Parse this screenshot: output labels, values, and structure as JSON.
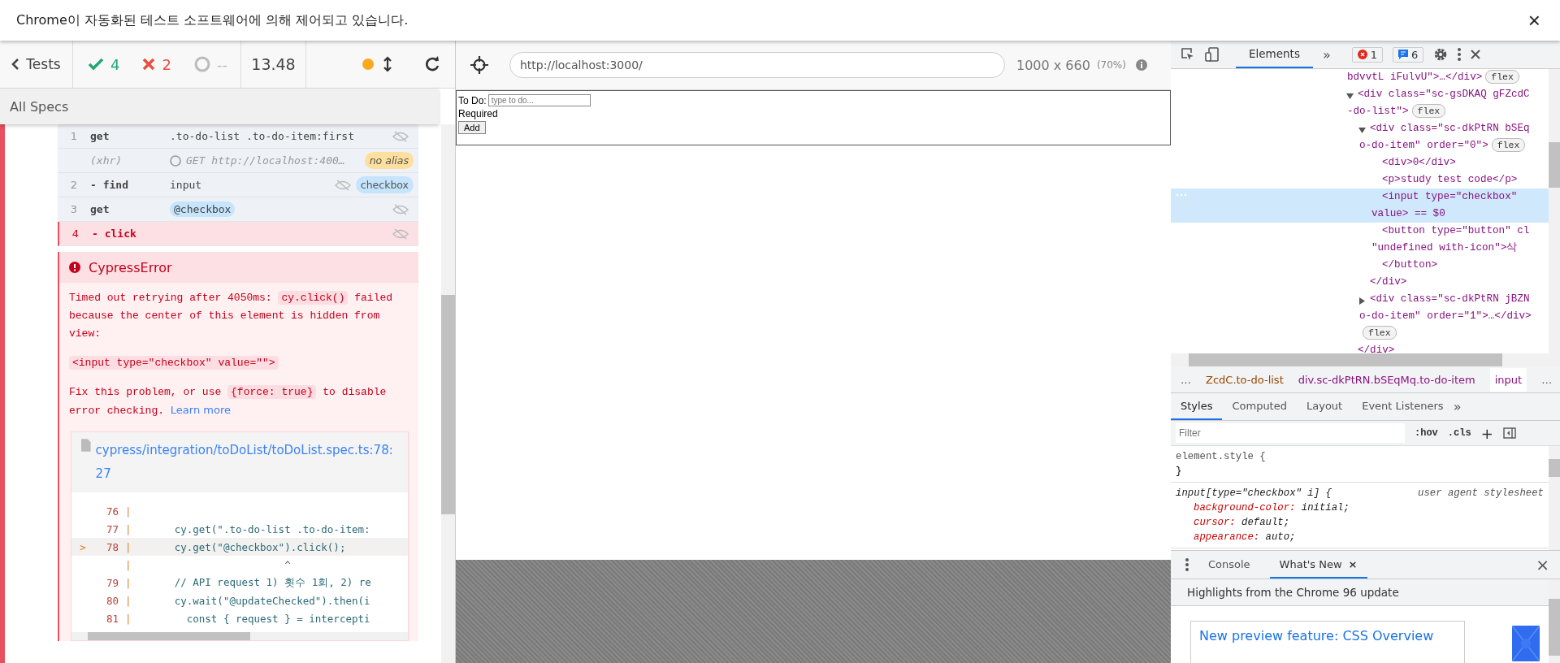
{
  "infobar": {
    "message": "Chrome이 자동화된 테스트 소프트웨어에 의해 제어되고 있습니다.",
    "close": "×"
  },
  "reporter": {
    "back": "Tests",
    "passed": "4",
    "failed": "2",
    "pending": "--",
    "duration": "13.48",
    "specs": "All Specs",
    "commands": [
      {
        "number": "1",
        "name": "get",
        "message": ".to-do-list .to-do-item:first",
        "kind": "command",
        "failed": false
      },
      {
        "name": "(xhr)",
        "message": "GET http://localhost:400…",
        "kind": "xhr",
        "failed": false,
        "alias": {
          "label": "no alias",
          "color": "#ffdf9e"
        }
      },
      {
        "number": "2",
        "name": "- find",
        "message": "input",
        "kind": "command",
        "failed": false,
        "alias": {
          "label": "checkbox",
          "color": "#c6e4fb"
        }
      },
      {
        "number": "3",
        "name": "get",
        "message": "@checkbox",
        "kind": "alias-ref",
        "failed": false
      },
      {
        "number": "4",
        "name": "- click",
        "kind": "command",
        "failed": true
      }
    ],
    "error": {
      "title": "CypressError",
      "paragraphs": [
        [
          {
            "text": "Timed out retrying after 4050ms: ",
            "kind": "text"
          },
          {
            "text": "cy.click()",
            "kind": "code"
          },
          {
            "text": " failed because the center of this element is hidden from view:",
            "kind": "text"
          }
        ],
        [
          {
            "text": "<input type=\"checkbox\" value=\"\">",
            "kind": "code"
          }
        ],
        [
          {
            "text": "Fix this problem, or use ",
            "kind": "text"
          },
          {
            "text": "{force: true}",
            "kind": "code"
          },
          {
            "text": " to disable error checking. ",
            "kind": "text"
          },
          {
            "text": "Learn more",
            "kind": "link"
          }
        ]
      ],
      "file": "cypress/integration/toDoList/toDoList.spec.ts:78:27",
      "code": [
        {
          "number": "76",
          "gutter": "|",
          "current": false
        },
        {
          "number": "77",
          "gutter": "|",
          "code": "      cy.get(\".to-do-list .to-do-item:",
          "current": false
        },
        {
          "marker": ">",
          "number": "78",
          "gutter": "|",
          "code": "      cy.get(\"@checkbox\").click();",
          "current": true
        },
        {
          "gutter": "|",
          "code": "                        ^",
          "current": false
        },
        {
          "number": "79",
          "gutter": "|",
          "code": "      // API request 1) 횟수 1회, 2) re",
          "current": false
        },
        {
          "number": "80",
          "gutter": "|",
          "code": "      cy.wait(\"@updateChecked\").then(i",
          "current": false
        },
        {
          "number": "81",
          "gutter": "|",
          "code": "        const { request } = intercepti",
          "current": false
        }
      ]
    }
  },
  "aut": {
    "url": "http://localhost:3000/",
    "viewport": "1000 x 660",
    "scale": "(70%)",
    "app": {
      "label": "To Do:",
      "placeholder": "type to do...",
      "required": "Required",
      "button": "Add"
    }
  },
  "devtools": {
    "tabs": [
      {
        "label": "Elements",
        "selected": true
      }
    ],
    "more": "»",
    "errors": "1",
    "messages": "6",
    "dom": [
      {
        "lines": [
          "bdvvtL iFulvU\">…</div>"
        ],
        "badge": "flex",
        "selected": false
      },
      {
        "lines": [
          "<div class=\"sc-gsDKAQ gFZcdC",
          "-do-list\">"
        ],
        "badge": "flex",
        "expanded": true,
        "selected": false,
        "closing": "</div>",
        "children": [
          {
            "lines": [
              "<div class=\"sc-dkPtRN bSEq",
              "o-do-item\" order=\"0\">"
            ],
            "badge": "flex",
            "expanded": true,
            "selected": false,
            "closing": "</div>",
            "children": [
              {
                "lines": [
                  "<div>0</div>"
                ],
                "selected": false
              },
              {
                "lines": [
                  "<p>study test code</p>"
                ],
                "selected": false
              },
              {
                "lines": [
                  "<input type=\"checkbox\"",
                  "value> == $0"
                ],
                "selected": true
              },
              {
                "lines": [
                  "<button type=\"button\" cl",
                  "\"undefined with-icon\">삭"
                ],
                "selected": false
              },
              {
                "lines": [
                  "</button>"
                ],
                "selected": false
              }
            ]
          },
          {
            "lines": [
              "<div class=\"sc-dkPtRN jBZN",
              "o-do-item\" order=\"1\">…</div>"
            ],
            "badge": "flex",
            "expanded": false,
            "selected": false
          }
        ]
      }
    ],
    "breadcrumbs": [
      {
        "label": "…",
        "selected": false
      },
      {
        "label": "ZcdC.to-do-list",
        "selected": false
      },
      {
        "label": "div.sc-dkPtRN.bSEqMq.to-do-item",
        "selected": false
      },
      {
        "label": "input",
        "selected": true
      },
      {
        "label": "…",
        "selected": false
      }
    ],
    "style_tabs": [
      {
        "label": "Styles",
        "selected": true
      },
      {
        "label": "Computed",
        "selected": false
      },
      {
        "label": "Layout",
        "selected": false
      },
      {
        "label": "Event Listeners",
        "selected": false
      }
    ],
    "filter": {
      "placeholder": "Filter"
    },
    "hov": ":hov",
    "cls": ".cls",
    "plus": "+",
    "rules": [
      {
        "selector": "element.style {",
        "close": "}"
      },
      {
        "selector": "input[type=\"checkbox\" i] {",
        "source": "user agent stylesheet",
        "declarations": [
          {
            "property": "background-color:",
            "value": "initial;"
          },
          {
            "property": "cursor:",
            "value": "default;"
          },
          {
            "property": "appearance:",
            "value": "auto;"
          }
        ]
      }
    ],
    "drawer_tabs": [
      {
        "label": "Console",
        "selected": false,
        "closable": false
      },
      {
        "label": "What's New",
        "selected": true,
        "closable": true
      }
    ],
    "tab_close": "×",
    "drawer_close": "×",
    "highlights": "Highlights from the Chrome 96 update",
    "card_title": "New preview feature: CSS Overview"
  }
}
